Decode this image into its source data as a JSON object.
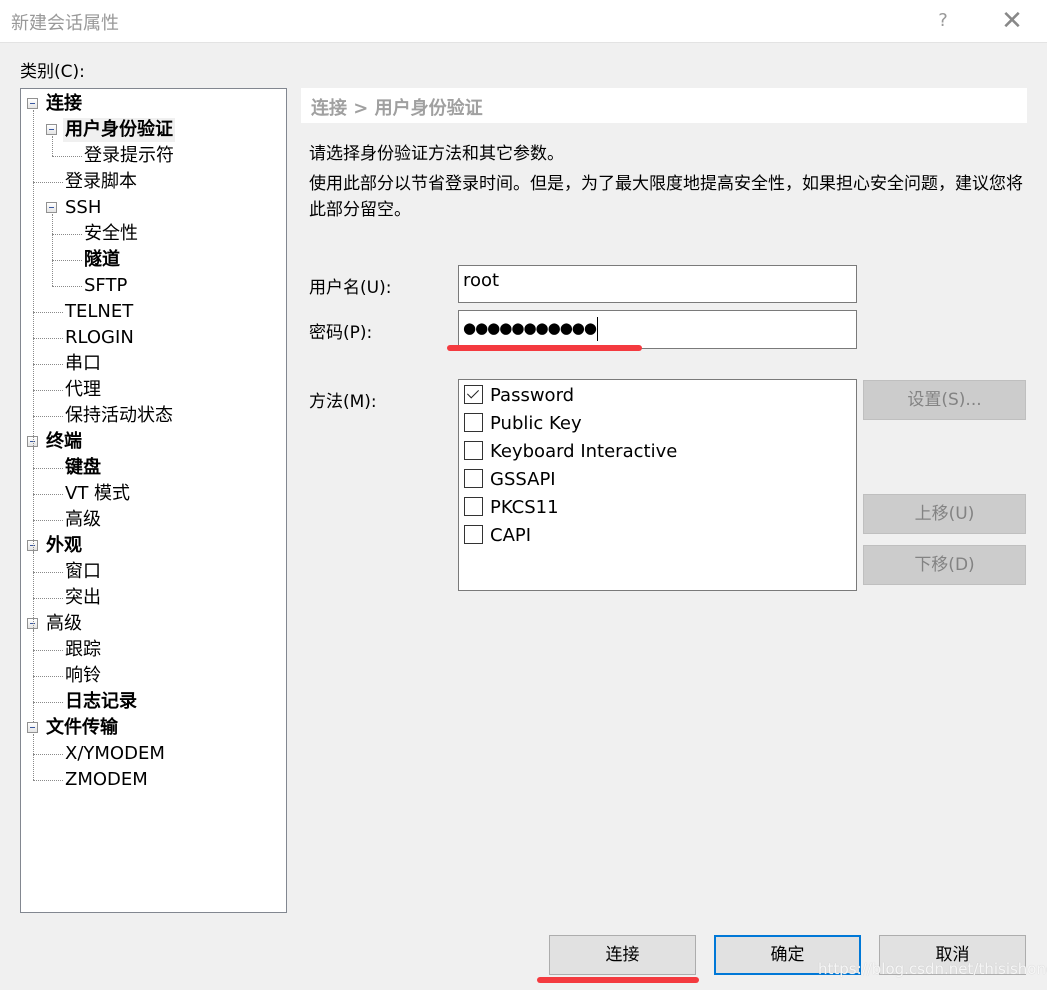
{
  "window": {
    "title": "新建会话属性",
    "help_label": "?",
    "close_label": "✕"
  },
  "category_label": "类别(C):",
  "tree": [
    {
      "label": "连接",
      "level": 0,
      "bold": true,
      "expanded": true
    },
    {
      "label": "用户身份验证",
      "level": 1,
      "bold": true,
      "expanded": true,
      "selected": true
    },
    {
      "label": "登录提示符",
      "level": 2,
      "bold": false
    },
    {
      "label": "登录脚本",
      "level": 1,
      "bold": false
    },
    {
      "label": "SSH",
      "level": 1,
      "bold": false,
      "expanded": true
    },
    {
      "label": "安全性",
      "level": 2,
      "bold": false
    },
    {
      "label": "隧道",
      "level": 2,
      "bold": true
    },
    {
      "label": "SFTP",
      "level": 2,
      "bold": false
    },
    {
      "label": "TELNET",
      "level": 1,
      "bold": false
    },
    {
      "label": "RLOGIN",
      "level": 1,
      "bold": false
    },
    {
      "label": "串口",
      "level": 1,
      "bold": false
    },
    {
      "label": "代理",
      "level": 1,
      "bold": false
    },
    {
      "label": "保持活动状态",
      "level": 1,
      "bold": false
    },
    {
      "label": "终端",
      "level": 0,
      "bold": true,
      "expanded": true
    },
    {
      "label": "键盘",
      "level": 1,
      "bold": true
    },
    {
      "label": "VT 模式",
      "level": 1,
      "bold": false
    },
    {
      "label": "高级",
      "level": 1,
      "bold": false
    },
    {
      "label": "外观",
      "level": 0,
      "bold": true,
      "expanded": true
    },
    {
      "label": "窗口",
      "level": 1,
      "bold": false
    },
    {
      "label": "突出",
      "level": 1,
      "bold": false
    },
    {
      "label": "高级",
      "level": 0,
      "bold": false,
      "expanded": true
    },
    {
      "label": "跟踪",
      "level": 1,
      "bold": false
    },
    {
      "label": "响铃",
      "level": 1,
      "bold": false
    },
    {
      "label": "日志记录",
      "level": 1,
      "bold": true
    },
    {
      "label": "文件传输",
      "level": 0,
      "bold": true,
      "expanded": true
    },
    {
      "label": "X/YMODEM",
      "level": 1,
      "bold": false
    },
    {
      "label": "ZMODEM",
      "level": 1,
      "bold": false
    }
  ],
  "panel": {
    "breadcrumb": "连接 > 用户身份验证",
    "description_1": "请选择身份验证方法和其它参数。",
    "description_2": "使用此部分以节省登录时间。但是，为了最大限度地提高安全性，如果担心安全问题，建议您将此部分留空。",
    "username_label": "用户名(U):",
    "username_value": "root",
    "password_label": "密码(P):",
    "password_value": "●●●●●●●●●●●",
    "method_label": "方法(M):",
    "methods": [
      {
        "label": "Password",
        "checked": true
      },
      {
        "label": "Public Key",
        "checked": false
      },
      {
        "label": "Keyboard Interactive",
        "checked": false
      },
      {
        "label": "GSSAPI",
        "checked": false
      },
      {
        "label": "PKCS11",
        "checked": false
      },
      {
        "label": "CAPI",
        "checked": false
      }
    ],
    "settings_button": "设置(S)...",
    "move_up_button": "上移(U)",
    "move_down_button": "下移(D)"
  },
  "footer": {
    "connect_button": "连接",
    "ok_button": "确定",
    "cancel_button": "取消"
  },
  "annotation_color": "#f43a3f",
  "watermark": "https://blog.csdn.net/thisishong"
}
